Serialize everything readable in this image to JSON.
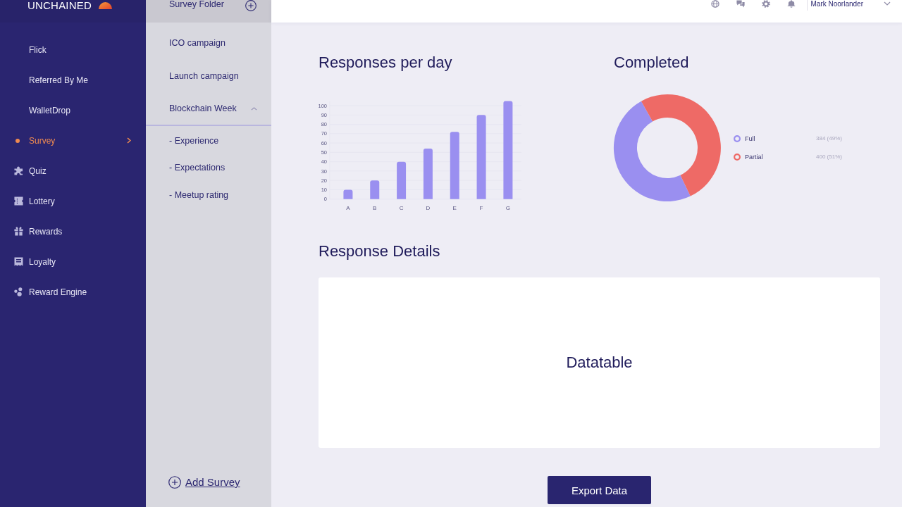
{
  "sidebar": {
    "logo": "UNCHAINED",
    "items": [
      {
        "label": "Flick",
        "selected": false
      },
      {
        "label": "Referred By Me",
        "selected": false
      },
      {
        "label": "WalletDrop",
        "selected": false
      },
      {
        "label": "Survey",
        "selected": true
      },
      {
        "label": "Quiz",
        "selected": false
      },
      {
        "label": "Lottery",
        "selected": false
      },
      {
        "label": "Rewards",
        "selected": false
      },
      {
        "label": "Loyalty",
        "selected": false
      },
      {
        "label": "Reward Engine",
        "selected": false
      }
    ]
  },
  "folder_panel": {
    "title": "Survey Folder",
    "folders": [
      {
        "label": "ICO campaign",
        "expanded": false
      },
      {
        "label": "Launch campaign",
        "expanded": false
      },
      {
        "label": "Blockchain Week",
        "expanded": true,
        "children": [
          {
            "label": "- Experience"
          },
          {
            "label": "- Expectations"
          },
          {
            "label": "- Meetup rating"
          }
        ]
      }
    ],
    "add_link": "Add Survey"
  },
  "top_bar": {
    "user_name": "Mark Noorlander"
  },
  "charts": [
    {
      "title": "Responses per day",
      "chart_data": {
        "type": "bar",
        "categories": [
          "A",
          "B",
          "C",
          "D",
          "E",
          "F",
          "G"
        ],
        "values": [
          10,
          20,
          40,
          54,
          72,
          90,
          105
        ],
        "color": "#9a8ff0",
        "ylim": [
          0,
          105
        ],
        "yticks": [
          0,
          10,
          20,
          30,
          40,
          50,
          60,
          70,
          80,
          90,
          100
        ],
        "grid": true
      }
    },
    {
      "title": "Completed",
      "chart_data": {
        "type": "donut",
        "categories": [
          "Full",
          "Partial"
        ],
        "values": [
          384,
          400
        ],
        "colors": [
          "#9a8ff0",
          "#ee6a66"
        ],
        "legend": "right",
        "value_labels": [
          "384 (49%)",
          "400 (51%)"
        ]
      }
    }
  ],
  "response_details": {
    "title": "Response Details",
    "content_label": "Datatable"
  },
  "export_button": "Export Data"
}
